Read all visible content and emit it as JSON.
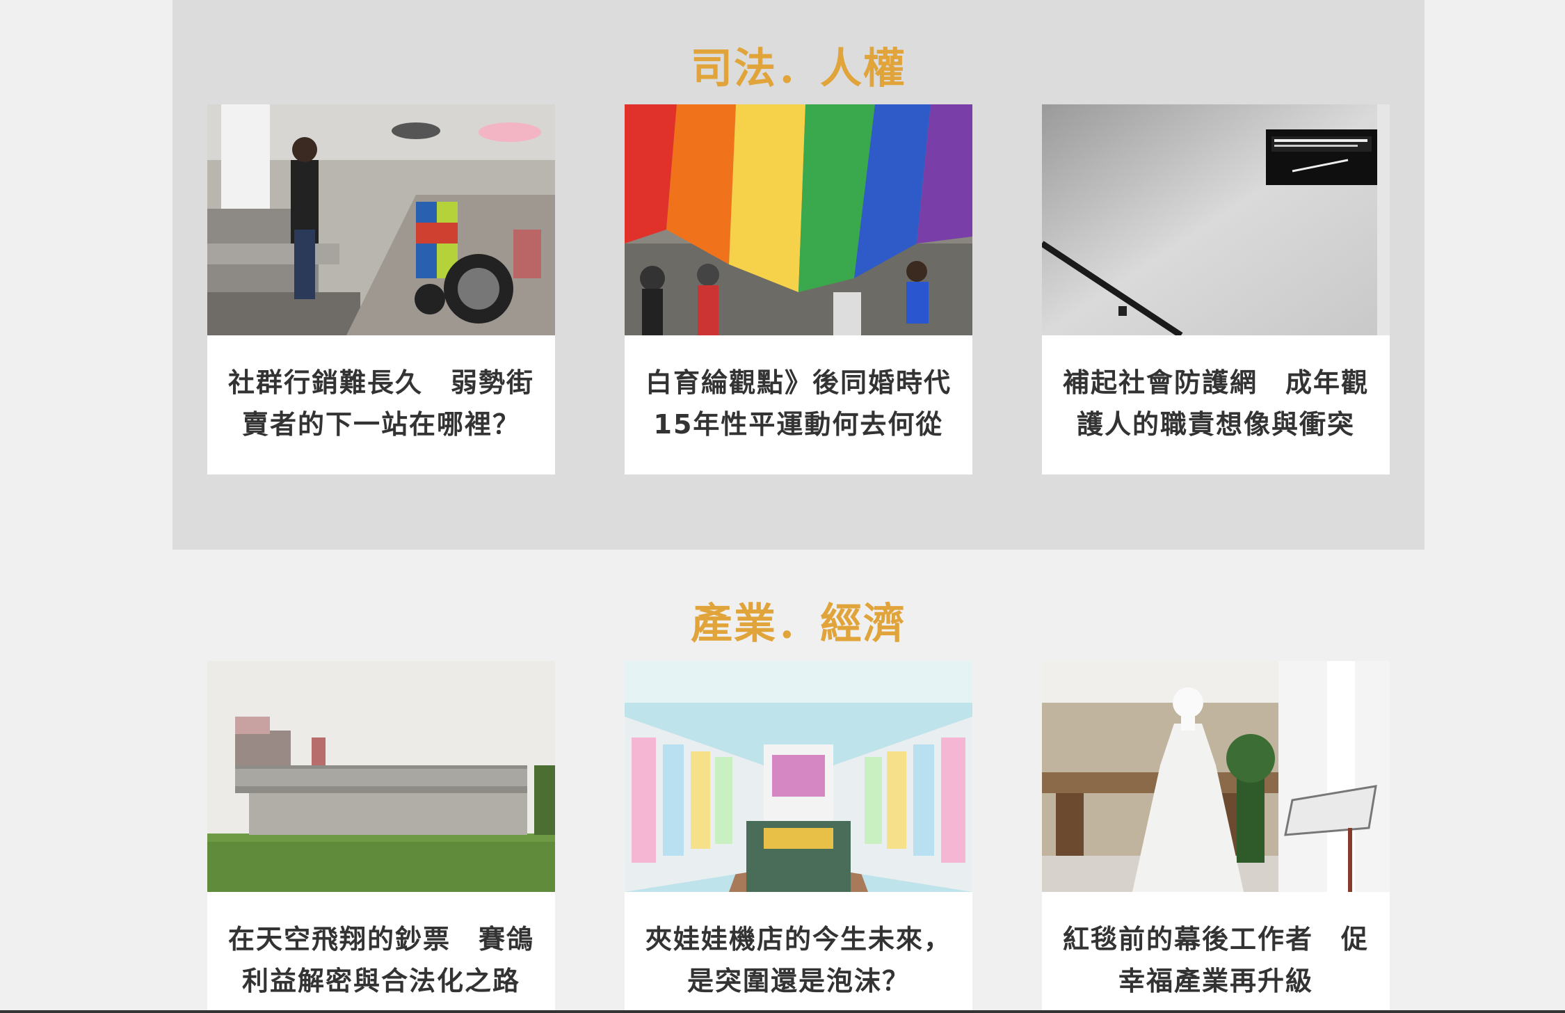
{
  "colors": {
    "page_background": "#f0f0f0",
    "section_shaded_background": "#dcdcdc",
    "heading_accent": "#e0a43a",
    "card_title": "#333333"
  },
  "sections": [
    {
      "title": "司法．人權",
      "cards": [
        {
          "title_line1": "社群行銷難長久　弱勢街",
          "title_line2": "賣者的下一站在哪裡？",
          "image": "street-vendor-wheelchair-photo"
        },
        {
          "title_line1": "白育綸觀點》後同婚時代",
          "title_line2": "15年性平運動何去何從",
          "image": "rainbow-flag-parade-photo"
        },
        {
          "title_line1": "補起社會防護網　成年觀",
          "title_line2": "護人的職責想像與衝突",
          "image": "probation-office-sign-photo"
        }
      ]
    },
    {
      "title": "產業．經濟",
      "cards": [
        {
          "title_line1": "在天空飛翔的鈔票　賽鴿",
          "title_line2": "利益解密與合法化之路",
          "image": "pigeon-loft-rice-field-photo"
        },
        {
          "title_line1": "夾娃娃機店的今生未來，",
          "title_line2": "是突圍還是泡沫？",
          "image": "claw-machine-arcade-photo"
        },
        {
          "title_line1": "紅毯前的幕後工作者　促",
          "title_line2": "幸福產業再升級",
          "image": "wedding-dress-shop-photo"
        }
      ]
    }
  ]
}
